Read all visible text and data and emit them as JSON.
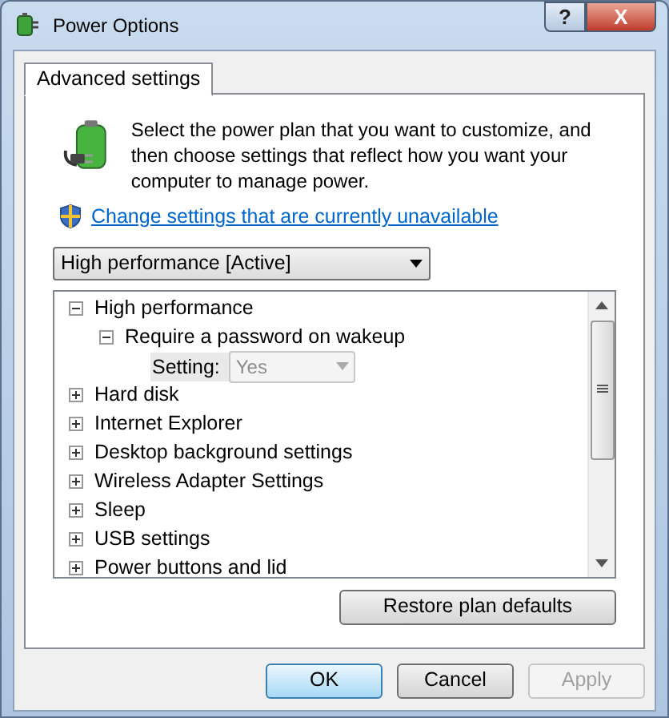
{
  "window": {
    "title": "Power Options"
  },
  "tabs": [
    {
      "label": "Advanced settings",
      "selected": true
    }
  ],
  "description": "Select the power plan that you want to customize, and then choose settings that reflect how you want your computer to manage power.",
  "link": "Change settings that are currently unavailable",
  "plan_dropdown": {
    "value": "High performance [Active]"
  },
  "tree": [
    {
      "label": "High performance",
      "expanded": true,
      "children": [
        {
          "label": "Require a password on wakeup",
          "expanded": true,
          "setting": {
            "label": "Setting:",
            "value": "Yes",
            "disabled": true
          }
        }
      ]
    },
    {
      "label": "Hard disk",
      "expanded": false
    },
    {
      "label": "Internet Explorer",
      "expanded": false
    },
    {
      "label": "Desktop background settings",
      "expanded": false
    },
    {
      "label": "Wireless Adapter Settings",
      "expanded": false
    },
    {
      "label": "Sleep",
      "expanded": false
    },
    {
      "label": "USB settings",
      "expanded": false
    },
    {
      "label": "Power buttons and lid",
      "expanded": false
    }
  ],
  "restore_button": "Restore plan defaults",
  "buttons": [
    {
      "label": "OK",
      "default": true,
      "disabled": false
    },
    {
      "label": "Cancel",
      "default": false,
      "disabled": false
    },
    {
      "label": "Apply",
      "default": false,
      "disabled": true
    }
  ],
  "title_buttons": [
    {
      "label": "?",
      "kind": "help"
    },
    {
      "label": "X",
      "kind": "close"
    }
  ]
}
